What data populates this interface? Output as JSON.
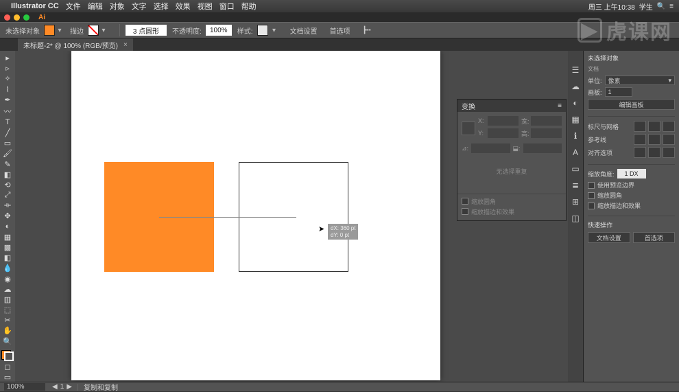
{
  "mac_menu": {
    "app": "Illustrator CC",
    "items": [
      "文件",
      "编辑",
      "对象",
      "文字",
      "选择",
      "效果",
      "视图",
      "窗口",
      "帮助"
    ],
    "clock": "周三 上午10:38",
    "user": "学生"
  },
  "control_bar": {
    "no_selection": "未选择对象",
    "stroke_label": "描边",
    "stroke_pt": "3 点圆形",
    "opacity_label": "不透明度:",
    "opacity_value": "100%",
    "style_label": "样式:",
    "doc_setup": "文档设置",
    "prefs": "首选项"
  },
  "doc_tab": {
    "title": "未标题-2* @ 100% (RGB/预览)"
  },
  "measure_tip": {
    "dx": "dX: 360 pt",
    "dy": "dY: 0 pt"
  },
  "float_panel": {
    "tab": "变换",
    "msg": "无选择重复",
    "foot1": "缩放圆角",
    "foot2": "缩放描边和效果"
  },
  "right": {
    "section1_title": "未选择对象",
    "section2_title": "文档",
    "units_label": "单位:",
    "units_value": "像素",
    "artboard_label": "画板:",
    "artboard_value": "1",
    "edit_artboard": "编辑画板",
    "ruler_grid": "标尺与网格",
    "guides": "参考线",
    "snap": "对齐选项",
    "scale_corner": "缩放角度: 1 DX",
    "chk1": "使用预览边界",
    "chk2": "缩放圆角",
    "chk3": "缩放描边和效果",
    "quick_ops": "快速操作",
    "doc_setup_btn": "文档设置",
    "prefs_btn": "首选项"
  },
  "status": {
    "zoom": "100%",
    "info": "复制和复制"
  },
  "watermark": "虎课网",
  "tools": [
    "▸",
    "▹",
    "✎",
    "T",
    "╱",
    "◻",
    "✂",
    "◐",
    "◑",
    "⟲",
    "▥",
    "◉",
    "✦",
    "◧",
    "⬚",
    "✋",
    "⊕"
  ]
}
